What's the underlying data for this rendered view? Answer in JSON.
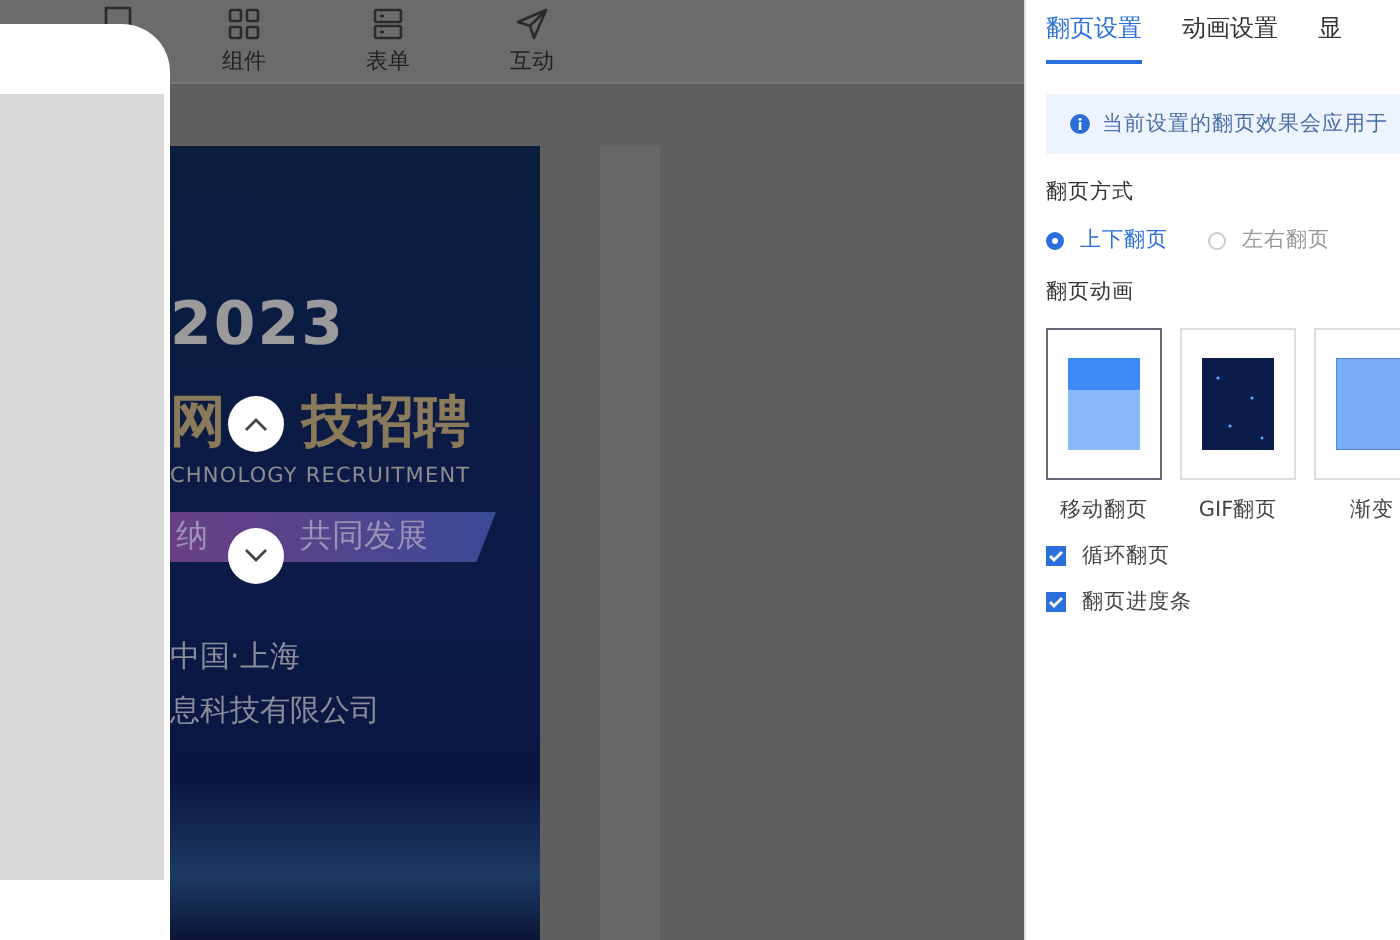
{
  "toolbar": {
    "items": [
      {
        "label": "组件",
        "kind": "grid"
      },
      {
        "label": "表单",
        "kind": "form"
      },
      {
        "label": "互动",
        "kind": "send"
      }
    ]
  },
  "poster": {
    "year": "2023",
    "headline_parts": [
      "网",
      "技招聘"
    ],
    "subtitle": "CHNOLOGY RECRUITMENT",
    "slogan_parts": [
      "纳",
      "共同发展"
    ],
    "location": "中国·上海",
    "company": "息科技有限公司"
  },
  "settings": {
    "tabs": [
      {
        "label": "翻页设置",
        "selected": true
      },
      {
        "label": "动画设置",
        "selected": false
      },
      {
        "label": "显",
        "selected": false
      }
    ],
    "notice": "当前设置的翻页效果会应用于",
    "mode_label": "翻页方式",
    "modes": [
      {
        "label": "上下翻页",
        "selected": true
      },
      {
        "label": "左右翻页",
        "selected": false
      }
    ],
    "animation_label": "翻页动画",
    "animations": [
      {
        "label": "移动翻页",
        "kind": "slide",
        "selected": true
      },
      {
        "label": "GIF翻页",
        "kind": "gif",
        "selected": false
      },
      {
        "label": "渐变",
        "kind": "fade",
        "selected": false
      }
    ],
    "options": [
      {
        "label": "循环翻页",
        "checked": true
      },
      {
        "label": "翻页进度条",
        "checked": true
      }
    ]
  }
}
